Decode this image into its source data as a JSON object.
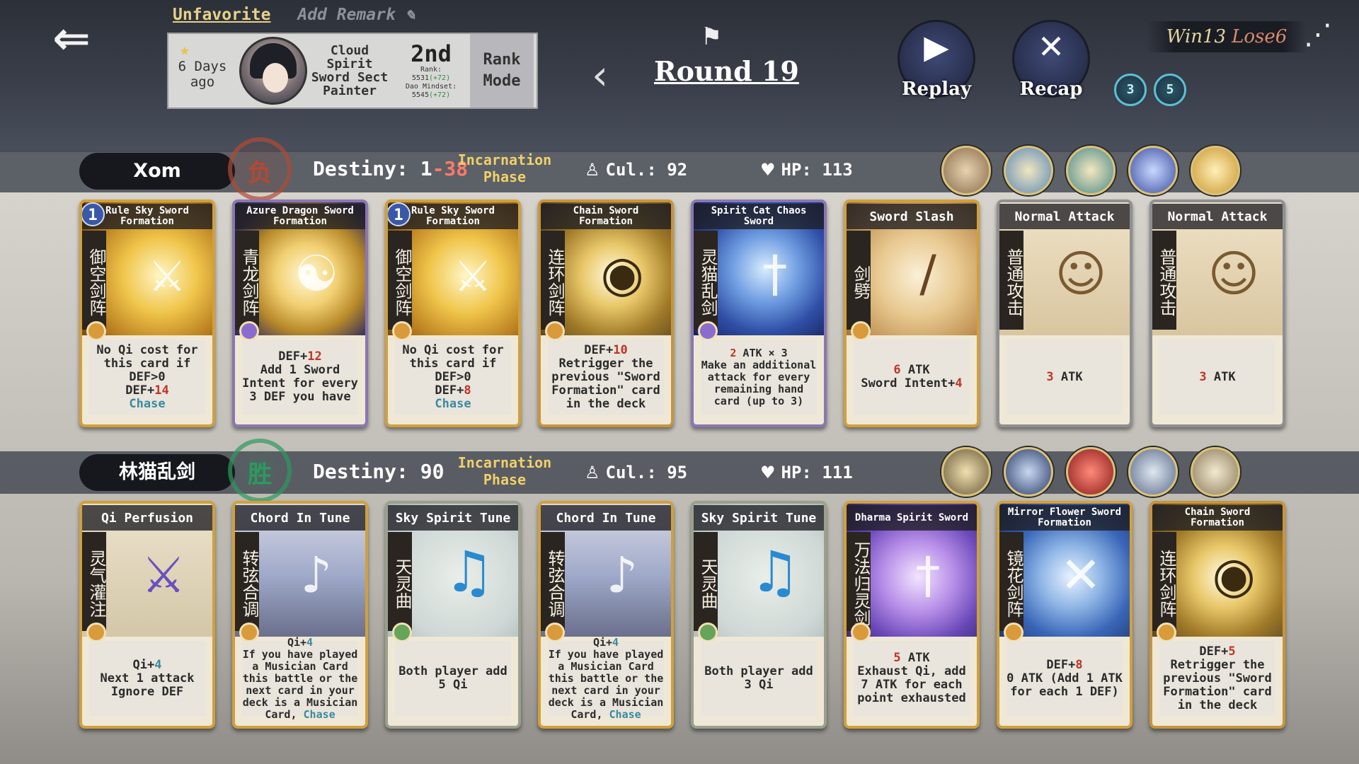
{
  "header": {
    "back_icon": "back-arrow-icon",
    "unfavorite": "Unfavorite",
    "add_remark": "Add Remark",
    "record": {
      "time_ago": "6 Days ago",
      "opponent": "Cloud Spirit Sword Sect Painter",
      "rank": "2nd",
      "rank_line": "Rank:",
      "rank_score": "5531",
      "rank_delta": "(+72)",
      "mindset_line": "Dao Mindset:",
      "mindset_score": "5545",
      "mindset_delta": "(+72)",
      "mode": "Rank Mode"
    },
    "round": "Round 19",
    "replay": "Replay",
    "recap": "Recap",
    "win": "Win13",
    "lose": "Lose6",
    "swirls": [
      "3",
      "5"
    ]
  },
  "players": [
    {
      "name": "Xom",
      "result_seal": "负",
      "destiny_label": "Destiny: ",
      "destiny_a": "1",
      "destiny_b": "-38",
      "phase": "Incarnation Phase",
      "cultivation": "Cul.: 92",
      "hp": "HP: 113",
      "cards": [
        {
          "title": "Rule Sky Sword Formation",
          "cn": "御空剑阵",
          "level": "1",
          "d1": "No Qi cost for this card if DEF>0",
          "d2a": "DEF+",
          "d2b": "14",
          "d3": "Chase"
        },
        {
          "title": "Azure Dragon Sword Formation",
          "cn": "青龙剑阵",
          "d1a": "DEF+",
          "d1b": "12",
          "d2": "Add 1 Sword Intent for every 3 DEF you have"
        },
        {
          "title": "Rule Sky Sword Formation",
          "cn": "御空剑阵",
          "level": "1",
          "d1": "No Qi cost for this card if DEF>0",
          "d2a": "DEF+",
          "d2b": "8",
          "d3": "Chase"
        },
        {
          "title": "Chain Sword Formation",
          "cn": "连环剑阵",
          "d1a": "DEF+",
          "d1b": "10",
          "d2": "Retrigger the previous \"Sword Formation\" card in the deck"
        },
        {
          "title": "Spirit Cat Chaos Sword",
          "cn": "灵猫乱剑",
          "d1a": "2",
          "d1b": " ATK × 3",
          "d2": "Make an additional attack for every remaining hand card (up to 3)"
        },
        {
          "title": "Sword Slash",
          "cn": "剑劈",
          "d1a": "6",
          "d1b": " ATK",
          "d2a": "Sword Intent+",
          "d2b": "4"
        },
        {
          "title": "Normal Attack",
          "cn": "普通攻击",
          "d1a": "3",
          "d1b": " ATK"
        },
        {
          "title": "Normal Attack",
          "cn": "普通攻击",
          "d1a": "3",
          "d1b": " ATK"
        }
      ]
    },
    {
      "name": "林猫乱剑",
      "result_seal": "胜",
      "destiny_label": "Destiny: ",
      "destiny_a": "90",
      "phase": "Incarnation Phase",
      "cultivation": "Cul.: 95",
      "hp": "HP: 111",
      "cards": [
        {
          "title": "Qi Perfusion",
          "cn": "灵气灌注",
          "d1a": "Qi+",
          "d1b": "4",
          "d2": "Next 1 attack Ignore DEF"
        },
        {
          "title": "Chord In Tune",
          "cn": "转弦合调",
          "d1a": "Qi+",
          "d1b": "4",
          "d2": "If you have played a Musician Card this battle or the next card in your deck is a Musician Card, ",
          "d3": "Chase"
        },
        {
          "title": "Sky Spirit Tune",
          "cn": "天灵曲",
          "d1": "Both player add 5 Qi"
        },
        {
          "title": "Chord In Tune",
          "cn": "转弦合调",
          "d1a": "Qi+",
          "d1b": "4",
          "d2": "If you have played a Musician Card this battle or the next card in your deck is a Musician Card, ",
          "d3": "Chase"
        },
        {
          "title": "Sky Spirit Tune",
          "cn": "天灵曲",
          "d1": "Both player add 3 Qi"
        },
        {
          "title": "Dharma Spirit Sword",
          "cn": "万法归灵剑",
          "d1a": "5",
          "d1b": " ATK",
          "d2": "Exhaust Qi, add 7 ATK for each point exhausted"
        },
        {
          "title": "Mirror Flower Sword Formation",
          "cn": "镜花剑阵",
          "d1a": "DEF+",
          "d1b": "8",
          "d2": "0 ATK (Add 1 ATK for each 1 DEF)"
        },
        {
          "title": "Chain Sword Formation",
          "cn": "连环剑阵",
          "d1a": "DEF+",
          "d1b": "5",
          "d2": "Retrigger the previous \"Sword Formation\" card in the deck"
        }
      ]
    }
  ],
  "colors": {
    "accent_gold": "#e7d28a",
    "lose_red": "#b24a32",
    "win_green": "#2c9a5e",
    "number_red": "#c03424",
    "keyword_teal": "#3a8aa0"
  }
}
